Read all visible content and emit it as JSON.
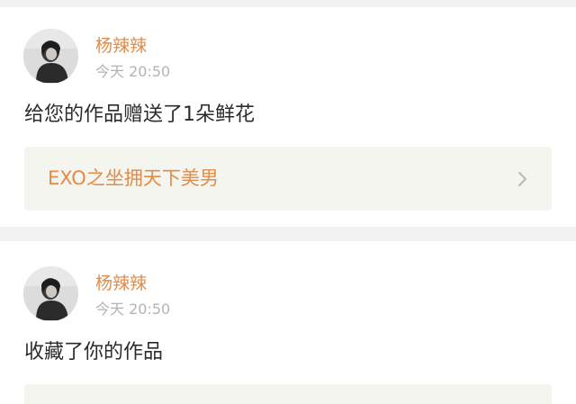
{
  "notifications": [
    {
      "user_name": "杨辣辣",
      "time": "今天 20:50",
      "message": "给您的作品赠送了1朵鲜花",
      "work_title": "EXO之坐拥天下美男",
      "link_icon": "chevron-right-icon",
      "avatar": "avatar-photo"
    },
    {
      "user_name": "杨辣辣",
      "time": "今天 20:50",
      "message": "收藏了你的作品",
      "avatar": "avatar-photo"
    }
  ],
  "colors": {
    "background": "#f2f2f2",
    "card": "#ffffff",
    "accent": "#e08c4b",
    "timestamp": "#b3b3b3",
    "message": "#2b2b2b",
    "work_link_background": "#f5f5ef"
  }
}
